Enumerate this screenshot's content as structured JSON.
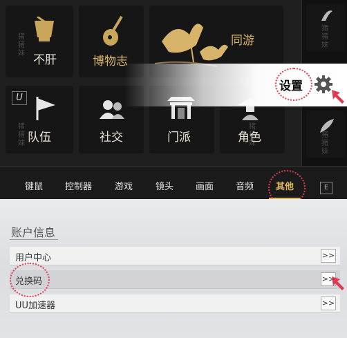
{
  "menu_tiles": [
    {
      "label": "不肝"
    },
    {
      "label": "博物志"
    },
    {
      "label": "同游"
    },
    {
      "label": "队伍"
    },
    {
      "label": "社交"
    },
    {
      "label": "门派"
    },
    {
      "label": "角色"
    }
  ],
  "settings": {
    "label": "设置"
  },
  "u_badge": "U",
  "watermark": "猪猪妹",
  "tabs": [
    {
      "label": "键鼠"
    },
    {
      "label": "控制器"
    },
    {
      "label": "游戏"
    },
    {
      "label": "镜头"
    },
    {
      "label": "画面"
    },
    {
      "label": "音频"
    },
    {
      "label": "其他",
      "active": true
    }
  ],
  "tab_end_icon": "E",
  "account": {
    "title": "账户信息",
    "rows": [
      {
        "label": "用户中心",
        "button": ">>"
      },
      {
        "label": "兑换码",
        "button": ">>"
      },
      {
        "label": "UU加速器",
        "button": ">>"
      }
    ]
  },
  "colors": {
    "accent": "#e0b65a",
    "annotation": "#e03a52"
  }
}
